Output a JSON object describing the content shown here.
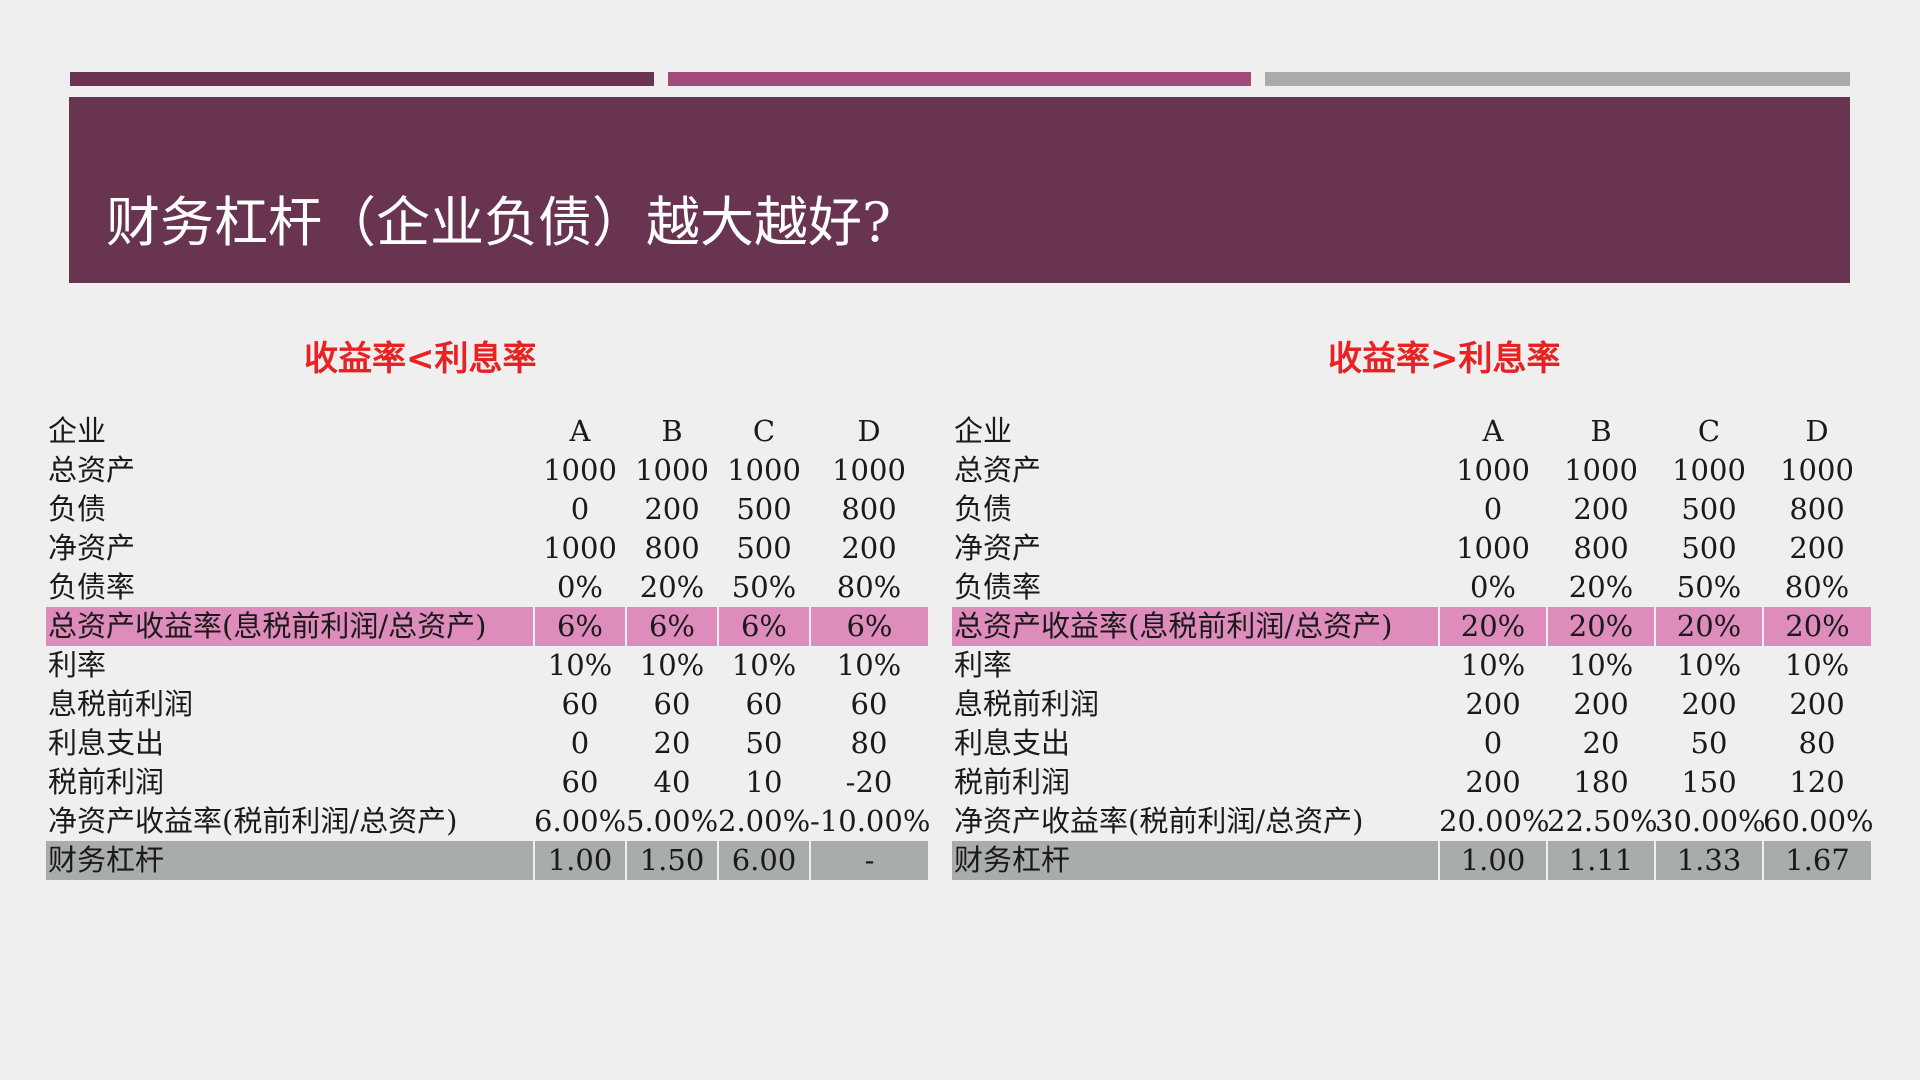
{
  "slide": {
    "title": "财务杠杆（企业负债）越大越好?"
  },
  "left": {
    "subtitle": "收益率<利息率",
    "columns": [
      "A",
      "B",
      "C",
      "D"
    ],
    "rows": [
      {
        "label": "企业",
        "values": [
          "A",
          "B",
          "C",
          "D"
        ],
        "style": "header"
      },
      {
        "label": "总资产",
        "values": [
          "1000",
          "1000",
          "1000",
          "1000"
        ],
        "style": ""
      },
      {
        "label": "负债",
        "values": [
          "0",
          "200",
          "500",
          "800"
        ],
        "style": ""
      },
      {
        "label": "净资产",
        "values": [
          "1000",
          "800",
          "500",
          "200"
        ],
        "style": ""
      },
      {
        "label": "负债率",
        "values": [
          "0%",
          "20%",
          "50%",
          "80%"
        ],
        "style": ""
      },
      {
        "label": "总资产收益率(息税前利润/总资产)",
        "values": [
          "6%",
          "6%",
          "6%",
          "6%"
        ],
        "style": "highlight"
      },
      {
        "label": "利率",
        "values": [
          "10%",
          "10%",
          "10%",
          "10%"
        ],
        "style": ""
      },
      {
        "label": "息税前利润",
        "values": [
          "60",
          "60",
          "60",
          "60"
        ],
        "style": ""
      },
      {
        "label": "利息支出",
        "values": [
          "0",
          "20",
          "50",
          "80"
        ],
        "style": ""
      },
      {
        "label": "税前利润",
        "values": [
          "60",
          "40",
          "10",
          "-20"
        ],
        "style": ""
      },
      {
        "label": "净资产收益率(税前利润/总资产)",
        "values": [
          "6.00%",
          "5.00%",
          "2.00%",
          "-10.00%"
        ],
        "style": ""
      },
      {
        "label": "财务杠杆",
        "values": [
          "1.00",
          "1.50",
          "6.00",
          "-"
        ],
        "style": "gray"
      }
    ]
  },
  "right": {
    "subtitle": "收益率>利息率",
    "columns": [
      "A",
      "B",
      "C",
      "D"
    ],
    "rows": [
      {
        "label": "企业",
        "values": [
          "A",
          "B",
          "C",
          "D"
        ],
        "style": "header"
      },
      {
        "label": "总资产",
        "values": [
          "1000",
          "1000",
          "1000",
          "1000"
        ],
        "style": ""
      },
      {
        "label": "负债",
        "values": [
          "0",
          "200",
          "500",
          "800"
        ],
        "style": ""
      },
      {
        "label": "净资产",
        "values": [
          "1000",
          "800",
          "500",
          "200"
        ],
        "style": ""
      },
      {
        "label": "负债率",
        "values": [
          "0%",
          "20%",
          "50%",
          "80%"
        ],
        "style": ""
      },
      {
        "label": "总资产收益率(息税前利润/总资产)",
        "values": [
          "20%",
          "20%",
          "20%",
          "20%"
        ],
        "style": "highlight"
      },
      {
        "label": "利率",
        "values": [
          "10%",
          "10%",
          "10%",
          "10%"
        ],
        "style": ""
      },
      {
        "label": "息税前利润",
        "values": [
          "200",
          "200",
          "200",
          "200"
        ],
        "style": ""
      },
      {
        "label": "利息支出",
        "values": [
          "0",
          "20",
          "50",
          "80"
        ],
        "style": ""
      },
      {
        "label": "税前利润",
        "values": [
          "200",
          "180",
          "150",
          "120"
        ],
        "style": ""
      },
      {
        "label": "净资产收益率(税前利润/总资产)",
        "values": [
          "20.00%",
          "22.50%",
          "30.00%",
          "60.00%"
        ],
        "style": ""
      },
      {
        "label": "财务杠杆",
        "values": [
          "1.00",
          "1.11",
          "1.33",
          "1.67"
        ],
        "style": "gray"
      }
    ]
  },
  "colors": {
    "header_bg": "#68344f",
    "accent_bar": "#a24a79",
    "gray_bar": "#a9acad",
    "highlight_row": "#dd8cbb",
    "subtitle_red": "#e82222"
  }
}
